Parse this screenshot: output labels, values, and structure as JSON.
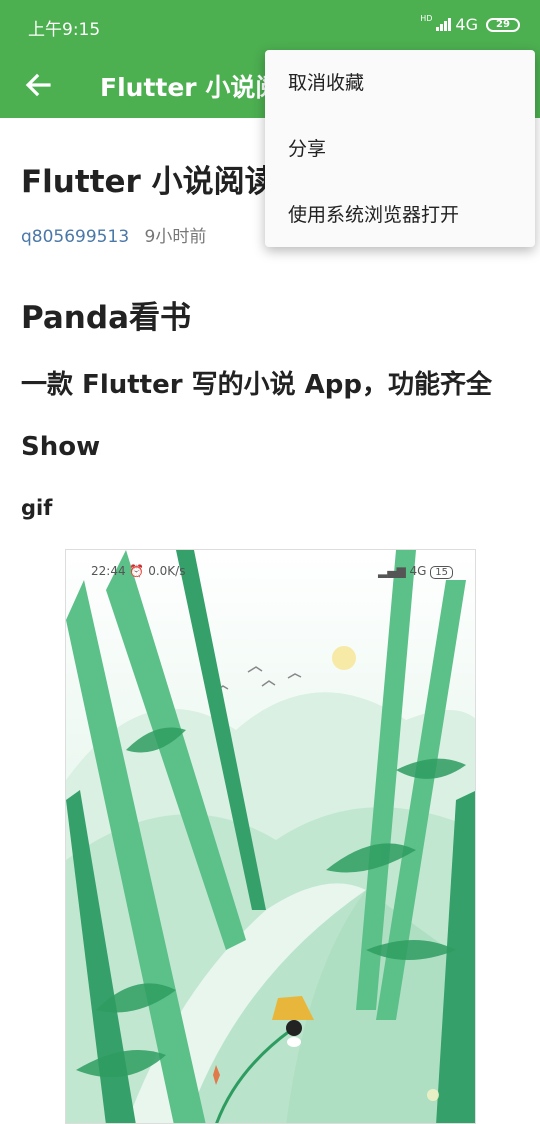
{
  "status_bar": {
    "time": "上午9:15",
    "hd": "HD",
    "network": "4G",
    "battery": "29"
  },
  "app_bar": {
    "title": "Flutter 小说阅读"
  },
  "article": {
    "title": "Flutter 小说阅读",
    "author": "q805699513",
    "time": "9小时前",
    "heading1": "Panda看书",
    "heading2": "一款 Flutter 写的小说 App，功能齐全",
    "heading3": "Show",
    "heading4": "gif"
  },
  "gif": {
    "time": "22:44",
    "speed": "0.0K/s",
    "network": "4G",
    "battery": "15"
  },
  "menu": {
    "items": [
      "取消收藏",
      "分享",
      "使用系统浏览器打开"
    ]
  },
  "colors": {
    "primary": "#4caf50",
    "link": "#4a78a8"
  }
}
